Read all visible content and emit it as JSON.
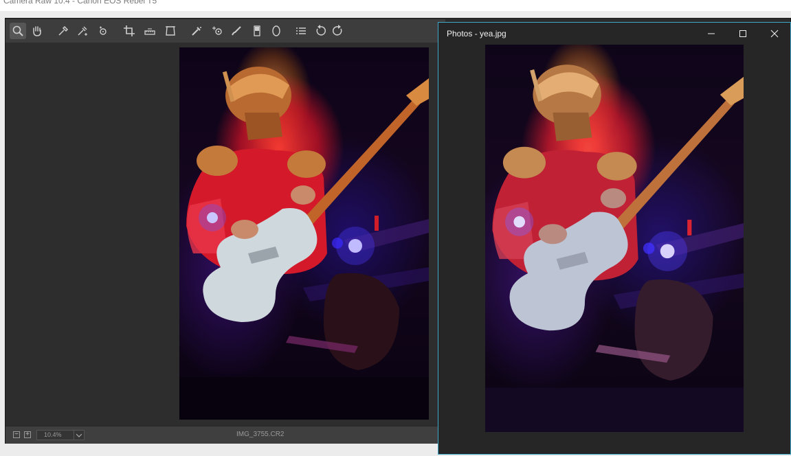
{
  "camera_raw": {
    "title": "Camera Raw 10.4  -  Canon EOS Rebel T5",
    "tools": [
      {
        "icon": "zoom-icon"
      },
      {
        "icon": "hand-icon"
      },
      {
        "icon": "white-balance-icon"
      },
      {
        "icon": "color-sampler-icon"
      },
      {
        "icon": "targeted-adjustment-icon"
      },
      {
        "icon": "crop-icon"
      },
      {
        "icon": "straighten-icon"
      },
      {
        "icon": "transform-icon"
      },
      {
        "icon": "spot-removal-icon"
      },
      {
        "icon": "red-eye-icon"
      },
      {
        "icon": "adjustment-brush-icon"
      },
      {
        "icon": "graduated-filter-icon"
      },
      {
        "icon": "radial-filter-icon"
      },
      {
        "icon": "preferences-list-icon"
      },
      {
        "icon": "rotate-left-icon"
      },
      {
        "icon": "rotate-right-icon"
      }
    ],
    "status": {
      "zoom_out_symbol": "−",
      "zoom_in_symbol": "+",
      "zoom_value": "10.4%",
      "filename": "IMG_3755.CR2"
    }
  },
  "photos_window": {
    "title": "Photos - yea.jpg"
  },
  "colors": {
    "accent_border": "#3fa9c9",
    "panel_dark": "#2b2b2b",
    "toolbar": "#3d3d3d"
  }
}
